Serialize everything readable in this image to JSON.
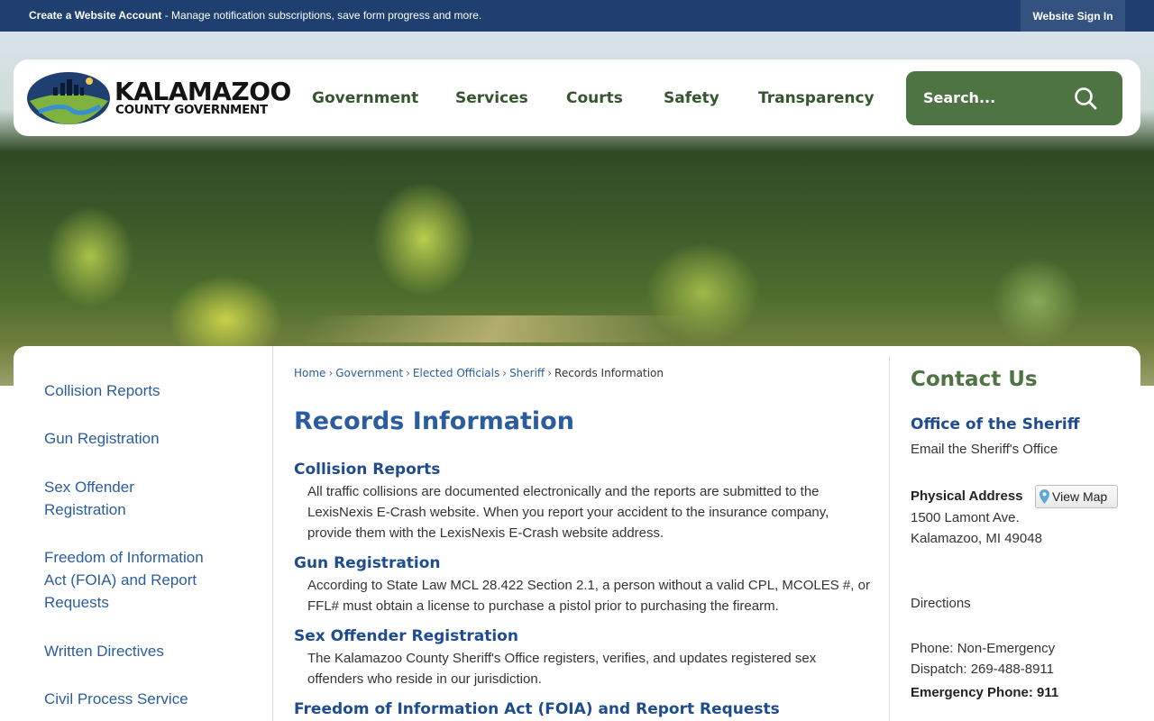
{
  "topbar": {
    "account_bold": "Create a Website Account",
    "account_rest": " - Manage notification subscriptions, save form progress and more.",
    "signin_label": "Website Sign In"
  },
  "header": {
    "logo_line1": "KALAMAZOO",
    "logo_line2": "COUNTY GOVERNMENT",
    "nav": [
      "Government",
      "Services",
      "Courts",
      "Safety",
      "Transparency"
    ],
    "search_placeholder": "Search..."
  },
  "sidebar": {
    "items": [
      "Collision Reports",
      "Gun Registration",
      "Sex Offender Registration",
      "Freedom of Information Act (FOIA) and Report Requests",
      "Written Directives",
      "Civil Process Service"
    ]
  },
  "breadcrumb": {
    "items": [
      "Home",
      "Government",
      "Elected Officials",
      "Sheriff"
    ],
    "current": "Records Information",
    "separator": "›"
  },
  "main": {
    "title": "Records Information",
    "sections": [
      {
        "heading": "Collision Reports",
        "body": "All traffic collisions are documented electronically and the reports are submitted to the LexisNexis E-Crash website. When you report your accident to the insurance company, provide them with the LexisNexis E-Crash website address."
      },
      {
        "heading": "Gun Registration",
        "body": "According to State Law MCL 28.422 Section 2.1, a person without a valid CPL, MCOLES #, or FFL# must obtain a license to purchase a pistol prior to purchasing the firearm."
      },
      {
        "heading": "Sex Offender Registration",
        "body": "The Kalamazoo County Sheriff's Office registers, verifies, and updates registered sex offenders who reside in our jurisdiction."
      },
      {
        "heading": "Freedom of Information Act (FOIA) and Report Requests",
        "body": ""
      }
    ]
  },
  "contact": {
    "title": "Contact Us",
    "office": "Office of the Sheriff",
    "email_link": "Email the Sheriff's Office",
    "address_label": "Physical Address",
    "view_map": "View Map",
    "address_line1": "1500 Lamont Ave.",
    "address_line2": "Kalamazoo, MI 49048",
    "directions": "Directions",
    "phone_label": "Phone: Non-Emergency",
    "dispatch": "Dispatch: 269-488-8911",
    "emergency": "Emergency Phone: 911"
  },
  "colors": {
    "topbar": "#1f3f70",
    "nav_text": "#35552e",
    "search_bg": "#4f7444",
    "link_blue": "#2b5c9e",
    "heading_blue": "#1f4c8f",
    "contact_green": "#4f7444"
  },
  "icons": {
    "search": "magnifier-icon",
    "map_pin": "map-pin-icon"
  }
}
